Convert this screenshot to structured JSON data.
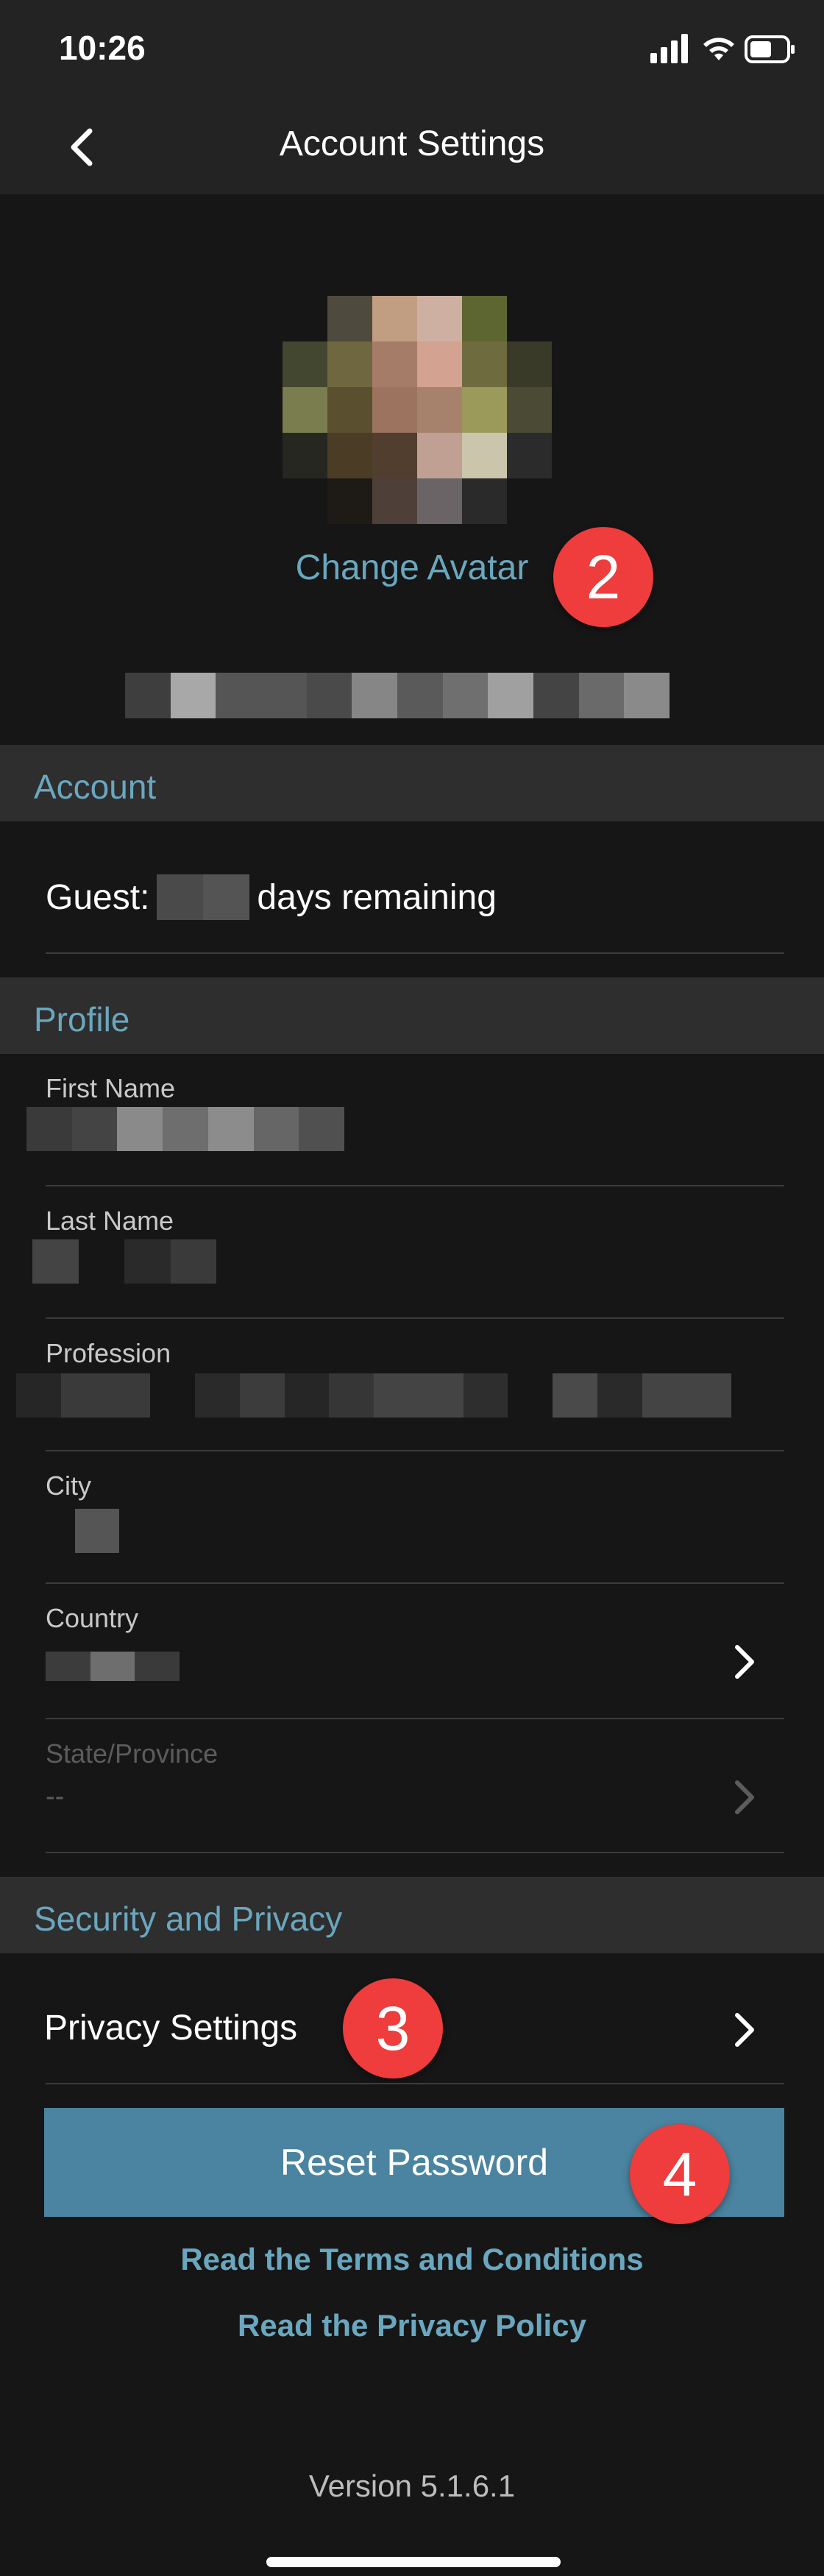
{
  "status_bar": {
    "time": "10:26"
  },
  "nav": {
    "title": "Account Settings"
  },
  "avatar": {
    "change_label": "Change Avatar",
    "tiles": [
      "#161616",
      "#4e4a3e",
      "#c19e82",
      "#cdb0a2",
      "#5d6630",
      "#161616",
      "#44472f",
      "#6e673f",
      "#a57c67",
      "#d4a290",
      "#6e6c3f",
      "#393b28",
      "#7a7e4f",
      "#5a5030",
      "#9b735f",
      "#a6826c",
      "#9c9a5b",
      "#4b4b35",
      "#272722",
      "#4b3c26",
      "#513e2e",
      "#bfa092",
      "#cbc6ab",
      "#2b2b2b",
      "#161616",
      "#1e1b16",
      "#4e4038",
      "#6a6466",
      "#2a2a2a",
      "#161616"
    ]
  },
  "badges": {
    "two": "2",
    "three": "3",
    "four": "4"
  },
  "account": {
    "header": "Account",
    "guest_prefix": "Guest:",
    "guest_suffix": "days remaining"
  },
  "profile": {
    "header": "Profile",
    "first_name_label": "First Name",
    "last_name_label": "Last Name",
    "profession_label": "Profession",
    "city_label": "City",
    "country_label": "Country",
    "state_label": "State/Province",
    "state_value": "--"
  },
  "security": {
    "header": "Security and Privacy",
    "privacy_settings": "Privacy Settings",
    "reset_password": "Reset Password",
    "terms_link": "Read the Terms and Conditions",
    "privacy_link": "Read the Privacy Policy"
  },
  "version": "Version  5.1.6.1",
  "colors": {
    "accent": "#6aa7bf",
    "button": "#4b84a0",
    "badge": "#ef3c3c",
    "background": "#161616",
    "section": "#2e2e2e"
  }
}
